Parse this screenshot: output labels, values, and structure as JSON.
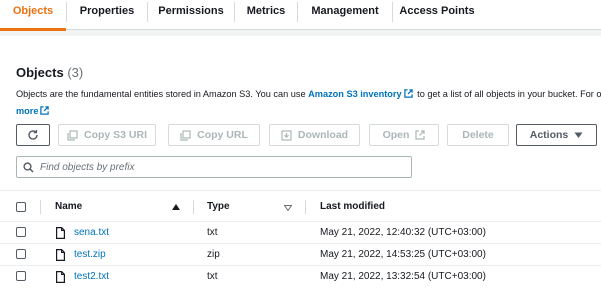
{
  "tabs": [
    {
      "label": "Objects",
      "active": true
    },
    {
      "label": "Properties",
      "active": false
    },
    {
      "label": "Permissions",
      "active": false
    },
    {
      "label": "Metrics",
      "active": false
    },
    {
      "label": "Management",
      "active": false
    },
    {
      "label": "Access Points",
      "active": false
    }
  ],
  "header": {
    "title": "Objects",
    "count": "(3)"
  },
  "description": {
    "part1": "Objects are the fundamental entities stored in Amazon S3. You can use",
    "inventory_link": "Amazon S3 inventory",
    "part2": "to get a list of all objects in your bucket. For others",
    "more_link": "more"
  },
  "toolbar": {
    "refresh_icon": "refresh-icon",
    "copy_s3_uri": "Copy S3 URI",
    "copy_url": "Copy URL",
    "download": "Download",
    "open": "Open",
    "delete": "Delete",
    "actions": "Actions"
  },
  "search": {
    "placeholder": "Find objects by prefix",
    "value": ""
  },
  "table": {
    "columns": {
      "name": "Name",
      "type": "Type",
      "last_modified": "Last modified"
    },
    "rows": [
      {
        "name": "sena.txt",
        "type": "txt",
        "last_modified": "May 21, 2022, 12:40:32 (UTC+03:00)"
      },
      {
        "name": "test.zip",
        "type": "zip",
        "last_modified": "May 21, 2022, 14:53:25 (UTC+03:00)"
      },
      {
        "name": "test2.txt",
        "type": "txt",
        "last_modified": "May 21, 2022, 13:32:54 (UTC+03:00)"
      }
    ]
  },
  "colors": {
    "accent": "#ec7211",
    "link": "#0073bb",
    "text": "#16191f",
    "disabled": "#aab7b8"
  }
}
